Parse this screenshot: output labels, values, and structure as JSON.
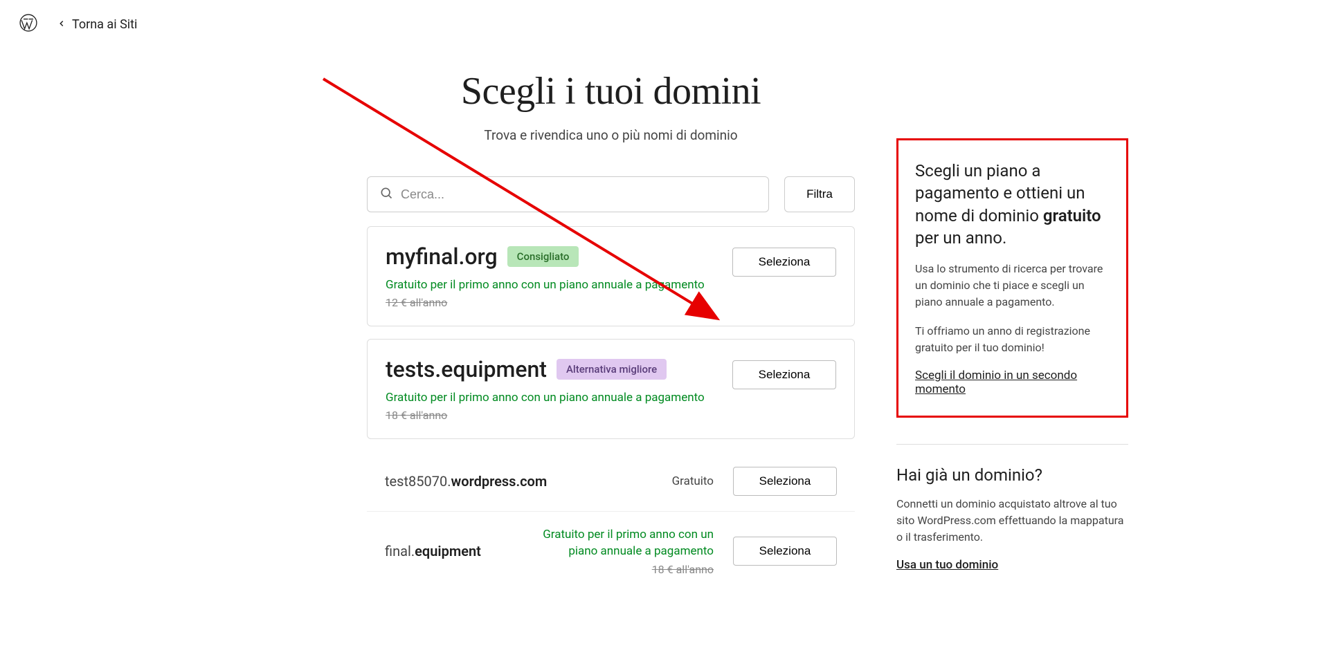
{
  "header": {
    "back_label": "Torna ai Siti"
  },
  "page": {
    "title": "Scegli i tuoi domini",
    "subtitle": "Trova e rivendica uno o più nomi di dominio"
  },
  "search": {
    "placeholder": "Cerca...",
    "filter_label": "Filtra"
  },
  "domains": {
    "featured": [
      {
        "name": "myfinal.org",
        "badge_type": "recommended",
        "badge_label": "Consigliato",
        "promo": "Gratuito per il primo anno con un piano annuale a pagamento",
        "price": "12 € all'anno",
        "select_label": "Seleziona"
      },
      {
        "name": "tests.equipment",
        "badge_type": "alternative",
        "badge_label": "Alternativa migliore",
        "promo": "Gratuito per il primo anno con un piano annuale a pagamento",
        "price": "18 € all'anno",
        "select_label": "Seleziona"
      }
    ],
    "simple": [
      {
        "prefix": "test85070.",
        "ext": "wordpress.com",
        "right_label": "Gratuito",
        "select_label": "Seleziona",
        "has_promo": false
      },
      {
        "prefix": "final.",
        "ext": "equipment",
        "right_promo": "Gratuito per il primo anno con un piano annuale a pagamento",
        "right_price": "18 € all'anno",
        "select_label": "Seleziona",
        "has_promo": true
      }
    ]
  },
  "sidebar": {
    "promo": {
      "title_1": "Scegli un piano a pagamento e ottieni un nome di dominio ",
      "title_bold": "gratuito",
      "title_2": " per un anno.",
      "para_1": "Usa lo strumento di ricerca per trovare un dominio che ti piace e scegli un piano annuale a pagamento.",
      "para_2": "Ti offriamo un anno di registrazione gratuito per il tuo dominio!",
      "skip_link": "Scegli il dominio in un secondo momento"
    },
    "existing": {
      "title": "Hai già un dominio?",
      "para": "Connetti un dominio acquistato altrove al tuo sito WordPress.com effettuando la mappatura o il trasferimento.",
      "use_link": "Usa un tuo dominio"
    }
  }
}
